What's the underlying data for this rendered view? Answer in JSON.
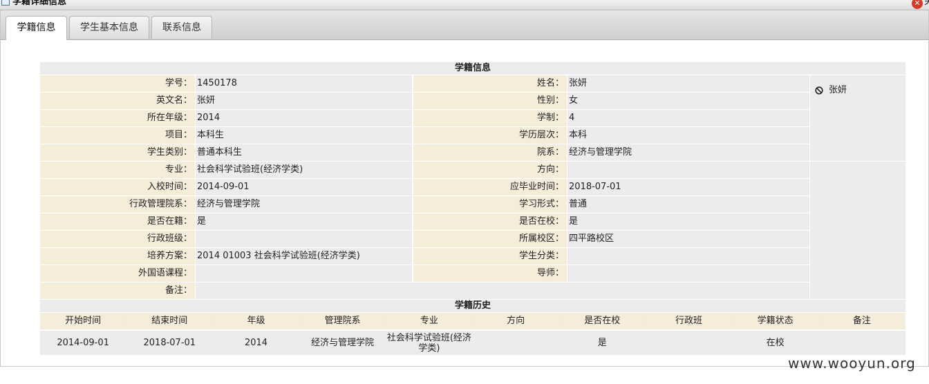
{
  "window": {
    "title": "学籍详细信息",
    "close_tail": "关"
  },
  "tabs": [
    {
      "label": "学籍信息",
      "active": true
    },
    {
      "label": "学生基本信息",
      "active": false
    },
    {
      "label": "联系信息",
      "active": false
    }
  ],
  "section_title": "学籍信息",
  "photo_name": "张妍",
  "fields": [
    {
      "l1": "学号：",
      "v1": "1450178",
      "l2": "姓名：",
      "v2": "张妍"
    },
    {
      "l1": "英文名：",
      "v1": "张妍",
      "l2": "性别：",
      "v2": "女"
    },
    {
      "l1": "所在年级：",
      "v1": "2014",
      "l2": "学制：",
      "v2": "4"
    },
    {
      "l1": "项目：",
      "v1": "本科生",
      "l2": "学历层次：",
      "v2": "本科"
    },
    {
      "l1": "学生类别：",
      "v1": "普通本科生",
      "l2": "院系：",
      "v2": "经济与管理学院"
    },
    {
      "l1": "专业：",
      "v1": "社会科学试验班(经济学类)",
      "l2": "方向：",
      "v2": ""
    },
    {
      "l1": "入校时间：",
      "v1": "2014-09-01",
      "l2": "应毕业时间：",
      "v2": "2018-07-01"
    },
    {
      "l1": "行政管理院系：",
      "v1": "经济与管理学院",
      "l2": "学习形式：",
      "v2": "普通"
    },
    {
      "l1": "是否在籍：",
      "v1": "是",
      "l2": "是否在校：",
      "v2": "是"
    },
    {
      "l1": "行政班级：",
      "v1": "",
      "l2": "所属校区：",
      "v2": "四平路校区"
    },
    {
      "l1": "培养方案：",
      "v1": "2014 01003 社会科学试验班(经济学类)",
      "l2": "学生分类：",
      "v2": ""
    },
    {
      "l1": "外国语课程：",
      "v1": "",
      "l2": "导师：",
      "v2": ""
    }
  ],
  "remark": {
    "label": "备注：",
    "value": ""
  },
  "history": {
    "title": "学籍历史",
    "columns": [
      "开始时间",
      "结束时间",
      "年级",
      "管理院系",
      "专业",
      "方向",
      "是否在校",
      "行政班",
      "学籍状态",
      "备注"
    ],
    "rows": [
      [
        "2014-09-01",
        "2018-07-01",
        "2014",
        "经济与管理学院",
        "社会科学试验班(经济学类)",
        "",
        "是",
        "",
        "在校",
        ""
      ]
    ]
  },
  "watermark": "www.wooyun.org",
  "colors": {
    "label_bg": "#f5ecda",
    "value_bg": "#ececec",
    "close": "#d43a26",
    "accent": "#3f6fa8"
  }
}
